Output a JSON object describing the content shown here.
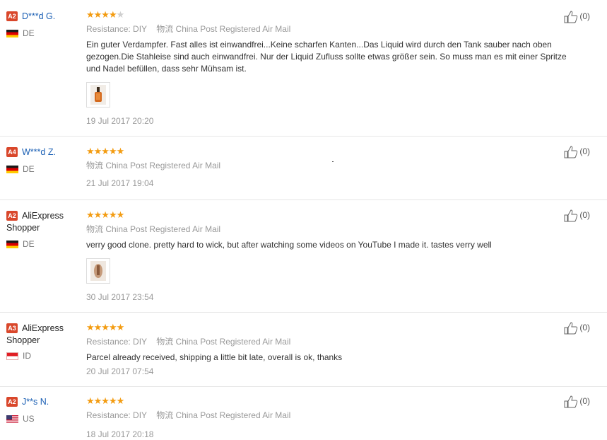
{
  "reviews": [
    {
      "level": "A2",
      "name": "D***d G.",
      "name_color": "#1a5fb4",
      "country": "DE",
      "flag": "de",
      "stars": 4,
      "resistance_label": "Resistance:",
      "resistance_value": "DIY",
      "logistics_icon_text": "物流",
      "logistics": "China Post Registered Air Mail",
      "text": "Ein guter Verdampfer. Fast alles ist einwandfrei...Keine scharfen Kanten...Das Liquid wird durch den Tank sauber nach oben gezogen.Die Stahleise sind auch einwandfrei. Nur der Liquid Zufluss sollte etwas größer sein. So muss man es mit einer Spritze und Nadel befüllen, dass sehr Mühsam ist.",
      "date": "19 Jul 2017 20:20",
      "helpful": "(0)"
    },
    {
      "level": "A4",
      "name": "W***d Z.",
      "name_color": "#1a5fb4",
      "country": "DE",
      "flag": "de",
      "stars": 5,
      "logistics_icon_text": "物流",
      "logistics": "China Post Registered Air Mail",
      "date": "21 Jul 2017 19:04",
      "helpful": "(0)"
    },
    {
      "level": "A2",
      "name_line1": "AliExpress",
      "name_line2": "Shopper",
      "country": "DE",
      "flag": "de",
      "stars": 5,
      "logistics_icon_text": "物流",
      "logistics": "China Post Registered Air Mail",
      "text": "verry good clone. pretty hard to wick, but after watching some videos on YouTube I made it. tastes verry well",
      "date": "30 Jul 2017 23:54",
      "helpful": "(0)"
    },
    {
      "level": "A3",
      "name_line1": "AliExpress",
      "name_line2": "Shopper",
      "country": "ID",
      "flag": "id",
      "stars": 5,
      "resistance_label": "Resistance:",
      "resistance_value": "DIY",
      "logistics_icon_text": "物流",
      "logistics": "China Post Registered Air Mail",
      "text": "Parcel already received, shipping a little bit late, overall is ok, thanks",
      "date": "20 Jul 2017 07:54",
      "helpful": "(0)"
    },
    {
      "level": "A2",
      "name": "J**s N.",
      "name_color": "#1a5fb4",
      "country": "US",
      "flag": "us",
      "stars": 5,
      "resistance_label": "Resistance:",
      "resistance_value": "DIY",
      "logistics_icon_text": "物流",
      "logistics": "China Post Registered Air Mail",
      "date": "18 Jul 2017 20:18",
      "helpful": "(0)"
    }
  ],
  "colors": {
    "star_on": "#f39c12",
    "star_off": "#cfcfcf",
    "level_badge": "#d9472b",
    "link": "#1a5fb4"
  }
}
